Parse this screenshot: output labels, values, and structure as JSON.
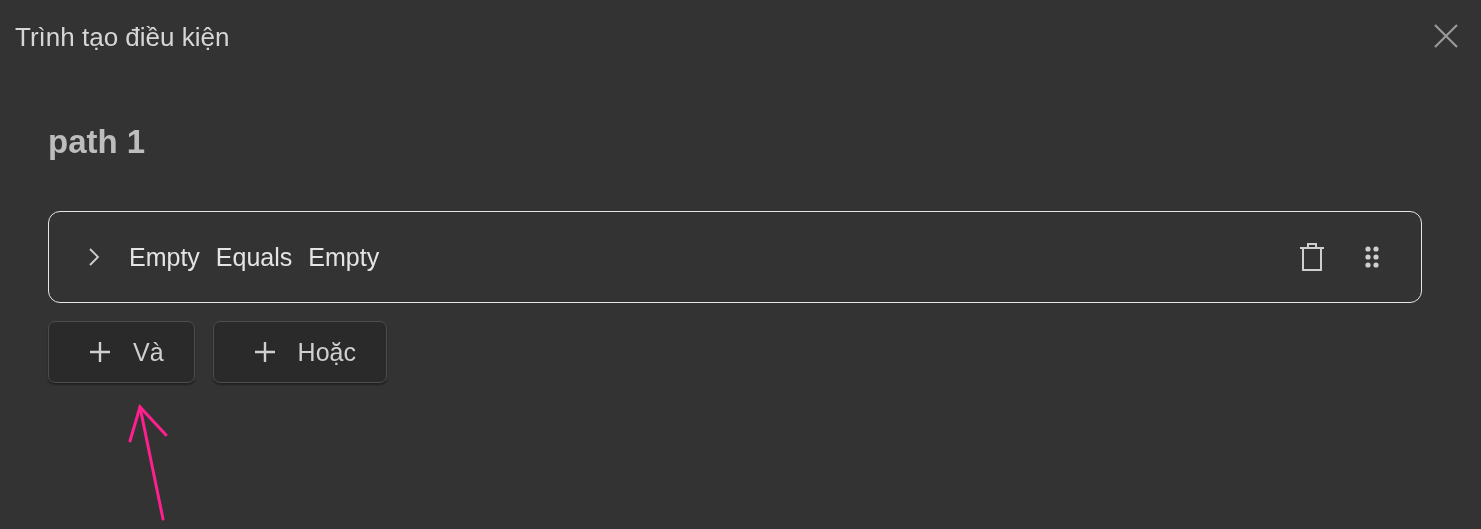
{
  "dialog": {
    "title": "Trình tạo điều kiện"
  },
  "path": {
    "name": "path 1",
    "conditions": [
      {
        "expanded": false,
        "field": "Empty",
        "operator": "Equals",
        "value": "Empty"
      }
    ],
    "buttons": [
      {
        "label": "Và"
      },
      {
        "label": "Hoặc"
      }
    ]
  }
}
